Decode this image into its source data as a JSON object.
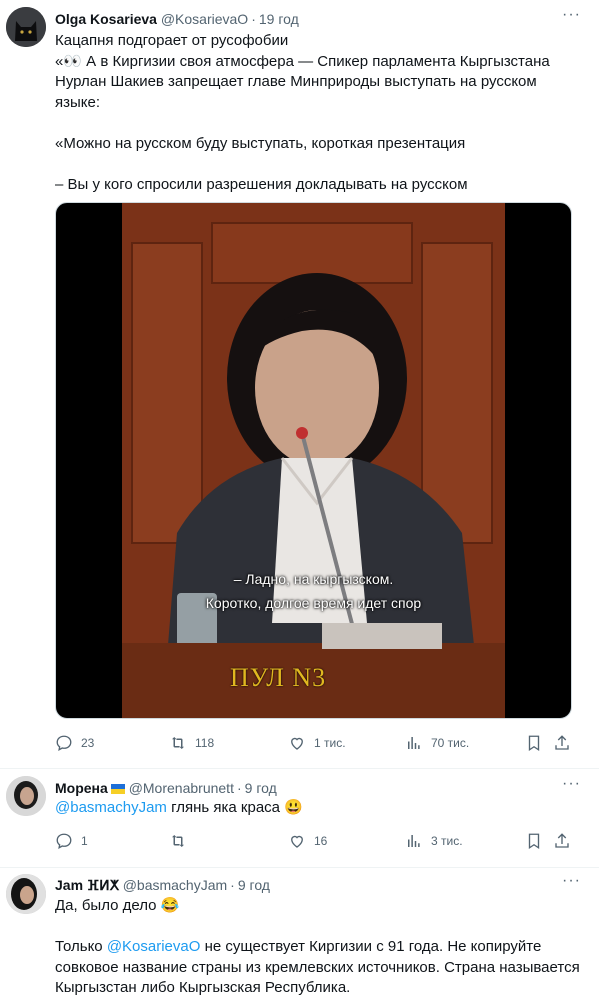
{
  "tweets": [
    {
      "name": "Olga Kosarieva",
      "handle": "@KosarievaO",
      "time": "19 год",
      "lines": [
        "Кацапня подгорает от русофобии",
        "«👀 А в Киргизии своя атмосфера — Спикер парламента Кыргызстана Нурлан Шакиев  запрещает главе Минприроды выступать на русском языке:",
        "",
        "«Можно на русском буду выступать, короткая презентация",
        "",
        "– Вы у кого спросили разрешения докладывать на русском"
      ],
      "media": {
        "caption_line1": "– Ладно, на кыргызском.",
        "caption_line2": "Коротко, долгое время идет спор",
        "watermark": "ПУЛ N3"
      },
      "stats": {
        "replies": "23",
        "retweets": "118",
        "likes": "1 тис.",
        "views": "70 тис."
      }
    },
    {
      "name": "Морена",
      "handle": "@Morenabrunett",
      "time": "9 год",
      "mention": "@basmachyJam",
      "text_rest": " глянь яка краса 😃",
      "stats": {
        "replies": "1",
        "retweets": "",
        "likes": "16",
        "views": "3 тис."
      }
    },
    {
      "name": "Jam ⴼⵍⵅ",
      "handle": "@basmachyJam",
      "time": "9 год",
      "line1": "Да, было дело 😂",
      "p2_before": "Только ",
      "p2_mention": "@KosarievaO",
      "p2_after": " не существует Киргизии с 91 года. Не копируйте совковое название страны из кремлевских источников. Страна называется Кыргызстан либо Кыргызская Республика."
    }
  ],
  "colors": {
    "accent": "#1d9bf0",
    "secondary": "#536471",
    "text": "#0f1419"
  }
}
